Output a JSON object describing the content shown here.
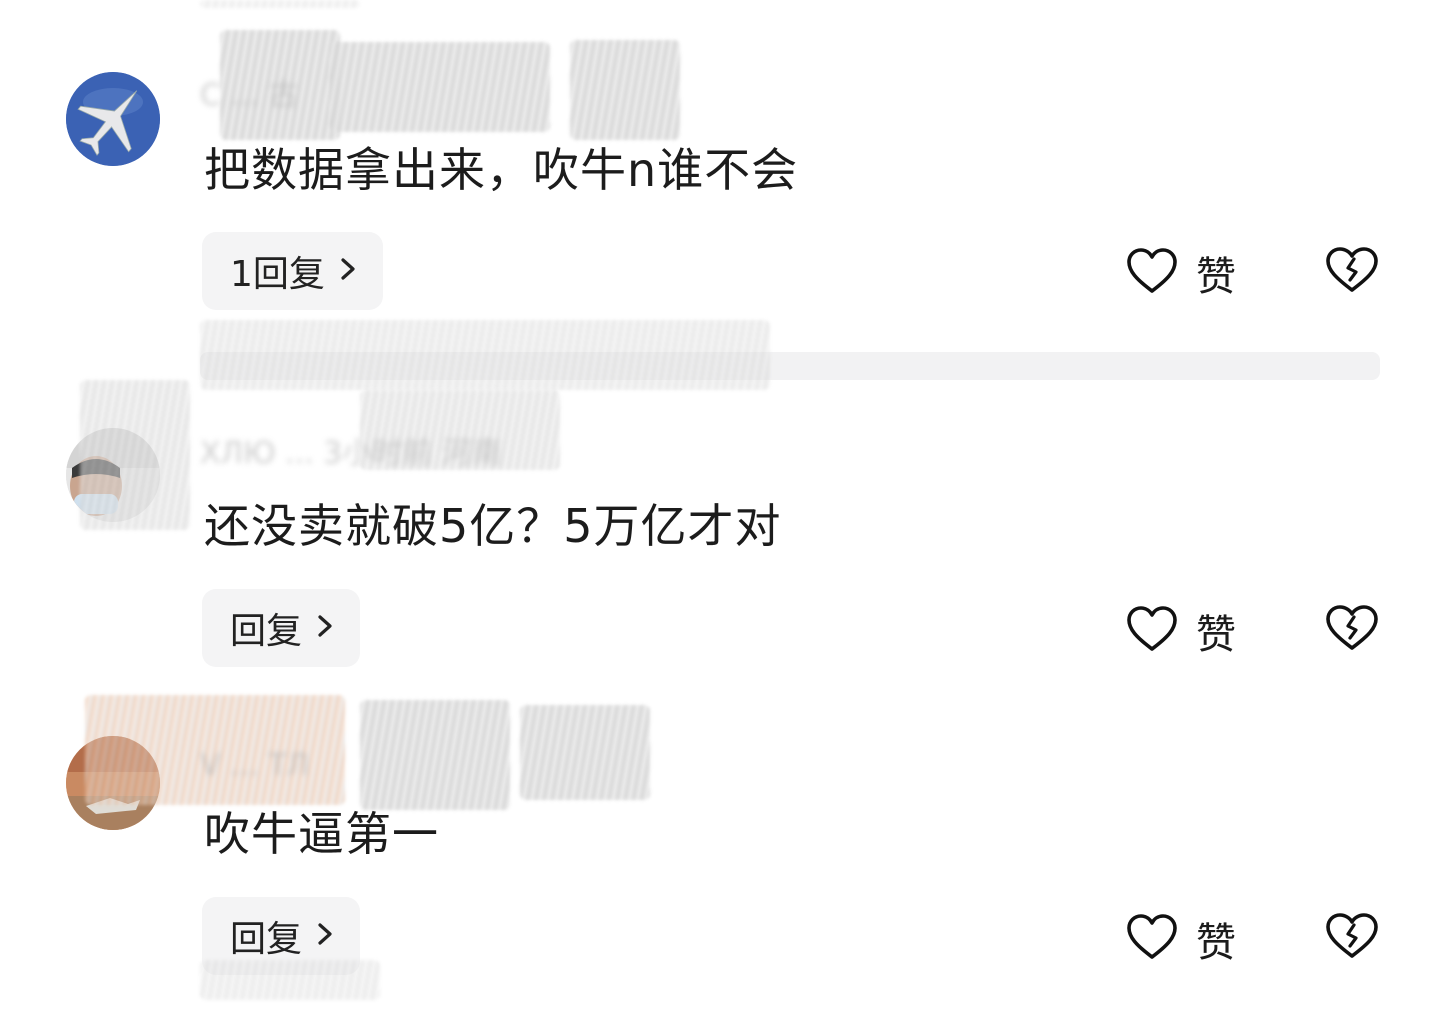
{
  "comments": [
    {
      "meta": "C  ...  古",
      "text": "把数据拿出来，吹牛n谁不会",
      "reply_label": "1回复",
      "like_label": "赞"
    },
    {
      "meta": "ХЛЮ  ...  3小时前  河南",
      "text": "还没卖就破5亿？5万亿才对",
      "reply_label": "回复",
      "like_label": "赞"
    },
    {
      "meta": "V  ...  ТЛ",
      "text": "吹牛逼第一",
      "reply_label": "回复",
      "like_label": "赞"
    }
  ],
  "icons": {
    "chevron": "chevron-right-icon",
    "like": "heart-icon",
    "dislike": "broken-heart-icon"
  },
  "colors": {
    "background": "#ffffff",
    "reply_bg": "#f4f4f5",
    "text": "#1c1c1c",
    "avatar1": "#3a63b5"
  }
}
